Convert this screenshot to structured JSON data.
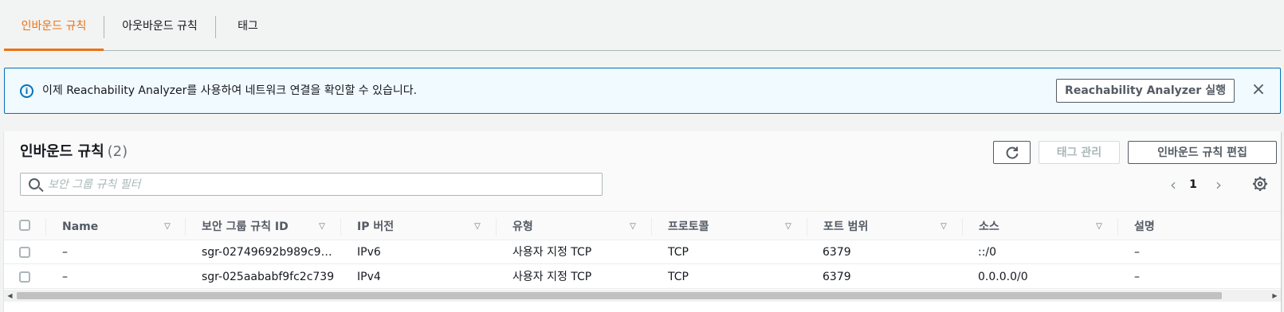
{
  "tabs": [
    {
      "label": "인바운드 규칙",
      "active": true
    },
    {
      "label": "아웃바운드 규칙",
      "active": false
    },
    {
      "label": "태그",
      "active": false
    }
  ],
  "banner": {
    "message": "이제 Reachability Analyzer를 사용하여 네트워크 연결을 확인할 수 있습니다.",
    "action_label": "Reachability Analyzer 실행",
    "close_icon": "×",
    "info_icon": "i"
  },
  "panel": {
    "title": "인바운드 규칙",
    "count": "(2)",
    "refresh_icon": "↻",
    "tag_manage_label": "태그 관리",
    "edit_label": "인바운드 규칙 편집",
    "filter_placeholder": "보안 그룹 규칙 필터",
    "pager": {
      "prev": "‹",
      "page": "1",
      "next": "›"
    }
  },
  "table": {
    "columns": [
      "Name",
      "보안 그룹 규칙 ID",
      "IP 버전",
      "유형",
      "프로토콜",
      "포트 범위",
      "소스",
      "설명"
    ],
    "rows": [
      [
        "–",
        "sgr-02749692b989c9…",
        "IPv6",
        "사용자 지정 TCP",
        "TCP",
        "6379",
        "::/0",
        "–"
      ],
      [
        "–",
        "sgr-025aababf9fc2c739",
        "IPv4",
        "사용자 지정 TCP",
        "TCP",
        "6379",
        "0.0.0.0/0",
        "–"
      ]
    ],
    "sort_icon": "▽"
  },
  "scrollbar": {
    "left": "◀",
    "right": "▶"
  },
  "colors": {
    "accent": "#ec7211",
    "info": "#0073bb"
  }
}
